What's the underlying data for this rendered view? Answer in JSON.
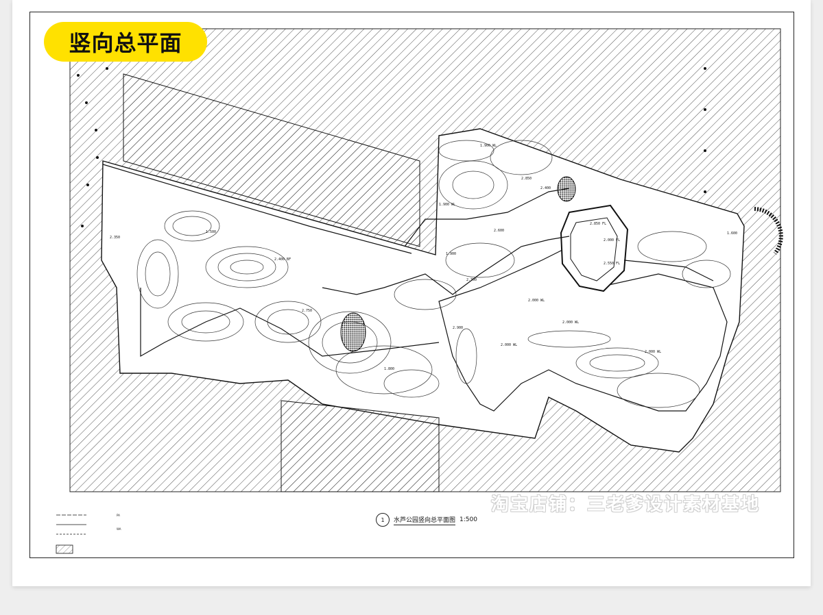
{
  "badge": {
    "title": "竖向总平面",
    "color": "#ffe100"
  },
  "drawing": {
    "title": "水芦公园竖向总平面图",
    "scale": "1:500",
    "number": "1"
  },
  "watermark": "淘宝店铺：三老爹设计素材基地",
  "legend": {
    "items": [
      "PA",
      "WA"
    ]
  },
  "elevation_labels": [
    "1.900 WL",
    "2.850",
    "2.400",
    "2.850 FL",
    "2.000 FL",
    "2.600",
    "1.900",
    "2.000 WL",
    "2.000 WL",
    "2.000 WL",
    "2.000 WL",
    "2.700",
    "1.500",
    "2.350",
    "1.800",
    "2.400 BF",
    "1.900 WL",
    "2.550 FL",
    "2.750",
    "1.600",
    "2.900"
  ]
}
